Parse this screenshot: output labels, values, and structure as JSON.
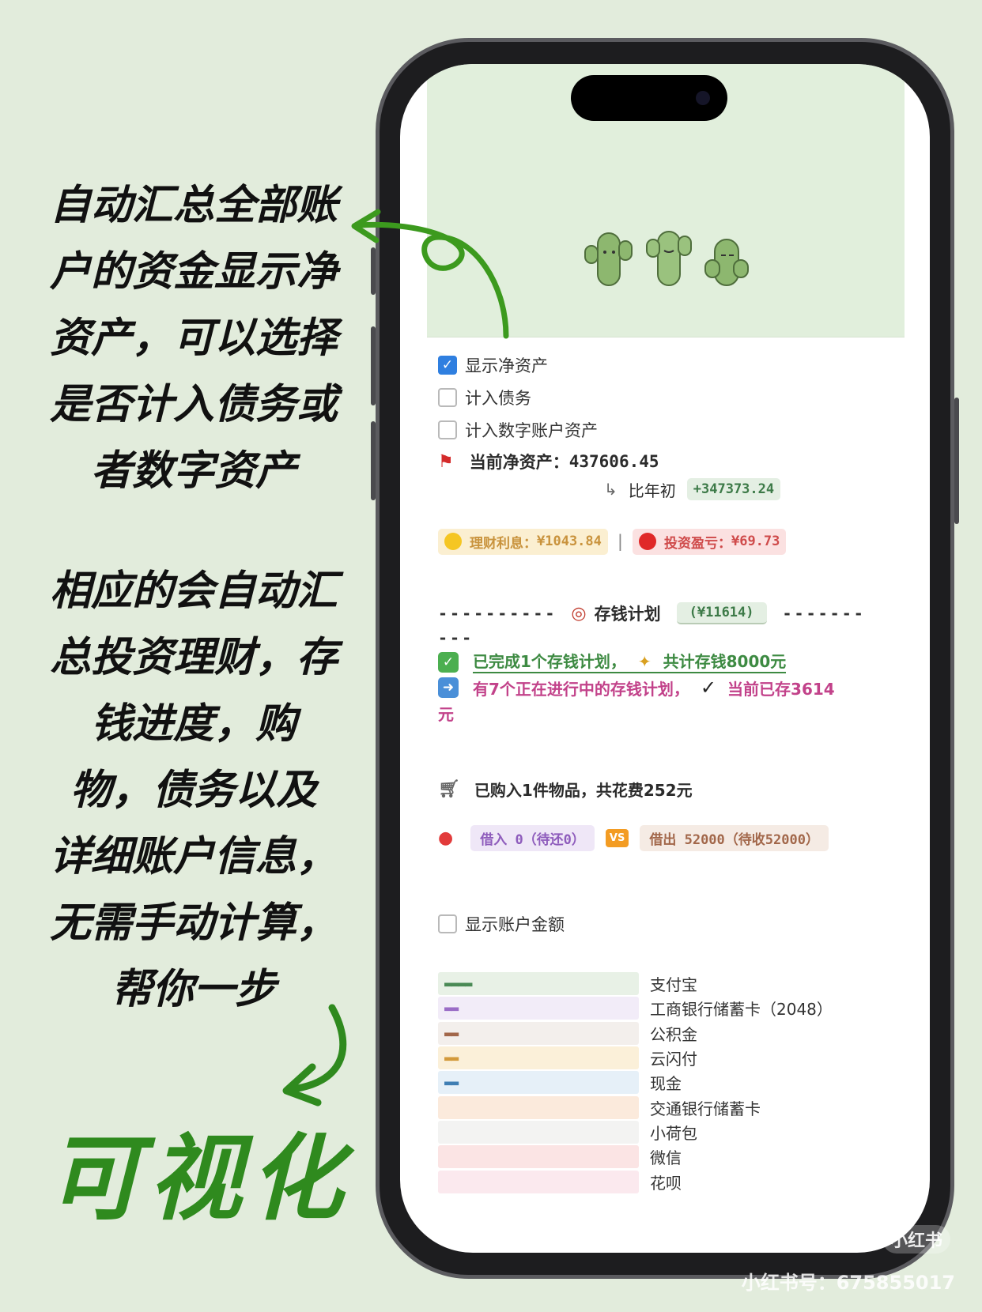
{
  "annotation": {
    "top_lines": [
      "自动汇总全部账",
      "户的资金显示净",
      "资产，可以选择",
      "是否计入债务或",
      "者数字资产"
    ],
    "bottom_lines": [
      "相应的会自动汇",
      "总投资理财，存",
      "钱进度，购",
      "物，债务以及",
      "详细账户信息，",
      "无需手动计算，",
      "帮你一步"
    ],
    "big_word": "可视化"
  },
  "toggles": {
    "show_net_assets": {
      "label": "显示净资产",
      "checked": true
    },
    "include_debt": {
      "label": "计入债务",
      "checked": false
    },
    "include_digital": {
      "label": "计入数字账户资产",
      "checked": false
    }
  },
  "net_worth": {
    "label": "当前净资产：",
    "value": "437606.45",
    "compare_label": "比年初",
    "compare_value": "+347373.24"
  },
  "finance": {
    "interest_label": "理财利息：",
    "interest_value": "¥1043.84",
    "invest_label": "投资盈亏：",
    "invest_value": "¥69.73"
  },
  "savings": {
    "dashes_left": "----------",
    "title": "存钱计划",
    "total": "(¥11614)",
    "dashes_right": "-------",
    "dashes_cont": "---",
    "completed_text": "已完成1个存钱计划，",
    "completed_sum": "共计存钱8000元",
    "ongoing_text": "有7个正在进行中的存钱计划，",
    "ongoing_current": "当前已存3614",
    "ongoing_unit": "元"
  },
  "purchase": {
    "text": "已购入1件物品，共花费252元"
  },
  "debt": {
    "borrow_in": "借入 0（待还0）",
    "vs": "VS",
    "lend_out": "借出 52000（待收52000）"
  },
  "account_toggle": {
    "label": "显示账户金额",
    "checked": false
  },
  "accounts": [
    {
      "name": "支付宝",
      "bar": "▬▬▬▬",
      "bg": "#e8f1e6",
      "fg": "#4a8a55"
    },
    {
      "name": "工商银行储蓄卡（2048）",
      "bar": "▬▬",
      "bg": "#f2ecf8",
      "fg": "#9a6cc6"
    },
    {
      "name": "公积金",
      "bar": "▬▬",
      "bg": "#f3efec",
      "fg": "#a2674a"
    },
    {
      "name": "云闪付",
      "bar": "▬▬",
      "bg": "#fbf0d9",
      "fg": "#d39a3b"
    },
    {
      "name": "现金",
      "bar": "▬▬",
      "bg": "#e6f0f8",
      "fg": "#3f7eb3"
    },
    {
      "name": "交通银行储蓄卡",
      "bar": "",
      "bg": "#fbeadc",
      "fg": "#c98a52"
    },
    {
      "name": "小荷包",
      "bar": "",
      "bg": "#f3f3f2",
      "fg": "#999999"
    },
    {
      "name": "微信",
      "bar": "",
      "bg": "#fbe4e4",
      "fg": "#cf4a4a"
    },
    {
      "name": "花呗",
      "bar": "",
      "bg": "#fbe9ee",
      "fg": "#c2428a"
    }
  ],
  "watermark": {
    "logo": "小红书",
    "id_text": "小红书号：675855017"
  }
}
